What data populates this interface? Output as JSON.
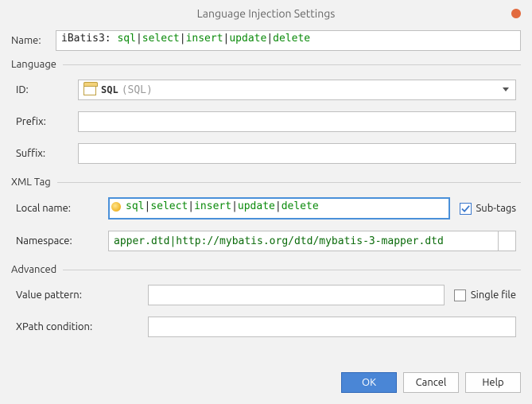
{
  "title": "Language Injection Settings",
  "nameLabel": "Name:",
  "nameValueTokens": [
    {
      "t": "iBatis3: ",
      "cls": "token-plain"
    },
    {
      "t": "sql",
      "cls": "token-green"
    },
    {
      "t": "|",
      "cls": "token-sep"
    },
    {
      "t": "select",
      "cls": "token-green"
    },
    {
      "t": "|",
      "cls": "token-sep"
    },
    {
      "t": "insert",
      "cls": "token-green"
    },
    {
      "t": "|",
      "cls": "token-sep"
    },
    {
      "t": "update",
      "cls": "token-green"
    },
    {
      "t": "|",
      "cls": "token-sep"
    },
    {
      "t": "delete",
      "cls": "token-green"
    }
  ],
  "groups": {
    "language": {
      "legend": "Language",
      "idLabel": "ID:",
      "idMain": "SQL",
      "idParen": "(SQL)",
      "prefixLabel": "Prefix:",
      "prefixValue": "",
      "suffixLabel": "Suffix:",
      "suffixValue": ""
    },
    "xml": {
      "legend": "XML Tag",
      "localNameLabel": "Local name:",
      "localNameTokens": [
        {
          "t": "sql",
          "cls": "token-green"
        },
        {
          "t": "|",
          "cls": "token-sep"
        },
        {
          "t": "select",
          "cls": "token-green"
        },
        {
          "t": "|",
          "cls": "token-sep"
        },
        {
          "t": "insert",
          "cls": "token-green"
        },
        {
          "t": "|",
          "cls": "token-sep"
        },
        {
          "t": "update",
          "cls": "token-green"
        },
        {
          "t": "|",
          "cls": "token-sep"
        },
        {
          "t": "delete",
          "cls": "token-green"
        }
      ],
      "subtagsLabel": "Sub-tags",
      "subtagsChecked": true,
      "namespaceLabel": "Namespace:",
      "namespaceValue": "apper.dtd|http://mybatis.org/dtd/mybatis-3-mapper.dtd"
    },
    "advanced": {
      "legend": "Advanced",
      "valuePatternLabel": "Value pattern:",
      "valuePatternValue": "",
      "singleFileLabel": "Single file",
      "singleFileChecked": false,
      "xpathLabel": "XPath condition:",
      "xpathValue": ""
    }
  },
  "buttons": {
    "ok": "OK",
    "cancel": "Cancel",
    "help": "Help"
  }
}
